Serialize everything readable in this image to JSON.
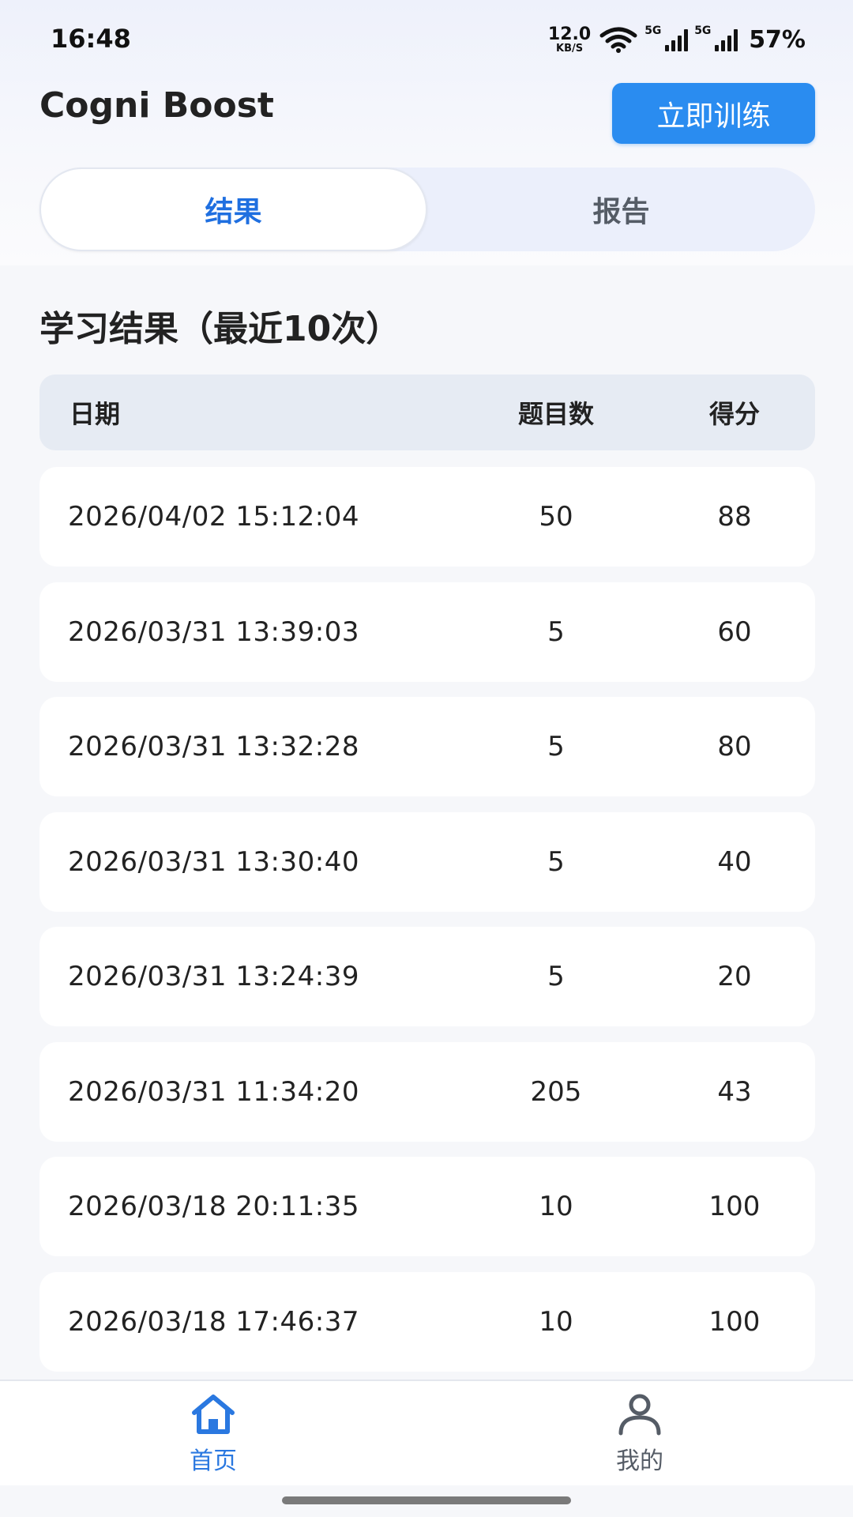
{
  "status_bar": {
    "time": "16:48",
    "net_speed_value": "12.0",
    "net_speed_unit": "KB/S",
    "signal1_tag": "5G",
    "signal2_tag": "5G",
    "battery": "57%",
    "icons": [
      "wifi-icon",
      "signal-icon",
      "signal-icon"
    ]
  },
  "header": {
    "app_title": "Cogni Boost",
    "train_button": "立即训练"
  },
  "tabs": [
    {
      "label": "结果",
      "active": true
    },
    {
      "label": "报告",
      "active": false
    }
  ],
  "results": {
    "title": "学习结果（最近10次）",
    "columns": [
      "日期",
      "题目数",
      "得分"
    ],
    "rows": [
      {
        "date": "2026/04/02 15:12:04",
        "count": "50",
        "score": "88"
      },
      {
        "date": "2026/03/31 13:39:03",
        "count": "5",
        "score": "60"
      },
      {
        "date": "2026/03/31 13:32:28",
        "count": "5",
        "score": "80"
      },
      {
        "date": "2026/03/31 13:30:40",
        "count": "5",
        "score": "40"
      },
      {
        "date": "2026/03/31 13:24:39",
        "count": "5",
        "score": "20"
      },
      {
        "date": "2026/03/31 11:34:20",
        "count": "205",
        "score": "43"
      },
      {
        "date": "2026/03/18 20:11:35",
        "count": "10",
        "score": "100"
      },
      {
        "date": "2026/03/18 17:46:37",
        "count": "10",
        "score": "100"
      }
    ]
  },
  "bottom_nav": [
    {
      "label": "首页",
      "icon": "home-icon",
      "active": true
    },
    {
      "label": "我的",
      "icon": "user-icon",
      "active": false
    }
  ],
  "colors": {
    "accent": "#2a8cf0",
    "active_tab_text": "#1f6fe0",
    "background": "#f6f7fa"
  }
}
